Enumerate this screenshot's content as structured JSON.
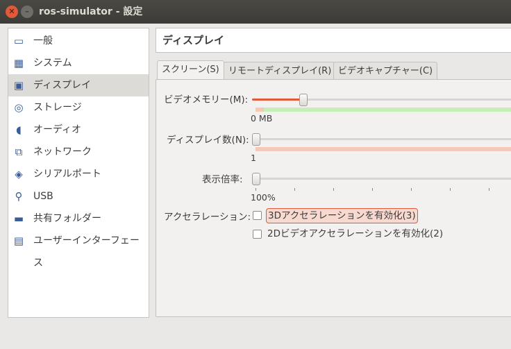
{
  "window": {
    "title": "ros-simulator - 設定"
  },
  "sidebar": {
    "items": [
      {
        "label": "一般",
        "icon": "general-icon"
      },
      {
        "label": "システム",
        "icon": "system-icon"
      },
      {
        "label": "ディスプレイ",
        "icon": "display-icon",
        "selected": true
      },
      {
        "label": "ストレージ",
        "icon": "storage-icon"
      },
      {
        "label": "オーディオ",
        "icon": "audio-icon"
      },
      {
        "label": "ネットワーク",
        "icon": "network-icon"
      },
      {
        "label": "シリアルポート",
        "icon": "serial-port-icon"
      },
      {
        "label": "USB",
        "icon": "usb-icon"
      },
      {
        "label": "共有フォルダー",
        "icon": "shared-folder-icon"
      },
      {
        "label": "ユーザーインターフェース",
        "icon": "user-interface-icon"
      }
    ]
  },
  "header": {
    "title": "ディスプレイ"
  },
  "tabs": [
    {
      "label": "スクリーン(S)",
      "active": true
    },
    {
      "label": "リモートディスプレイ(R)"
    },
    {
      "label": "ビデオキャプチャー(C)"
    }
  ],
  "screen": {
    "video_memory": {
      "label": "ビデオメモリー(M):",
      "min_label": "0 MB"
    },
    "monitor_count": {
      "label": "ディスプレイ数(N):",
      "min_label": "1"
    },
    "scale": {
      "label": "表示倍率:",
      "min_label": "100%"
    },
    "acceleration": {
      "label": "アクセラレーション:",
      "accel_3d": {
        "label": "3Dアクセラレーションを有効化(3)",
        "checked": false
      },
      "accel_2d": {
        "label": "2Dビデオアクセラレーションを有効化(2)",
        "checked": false
      }
    }
  },
  "colors": {
    "accent": "#e0593a",
    "ok": "#c6efb8",
    "warn": "#f6c8b8"
  }
}
